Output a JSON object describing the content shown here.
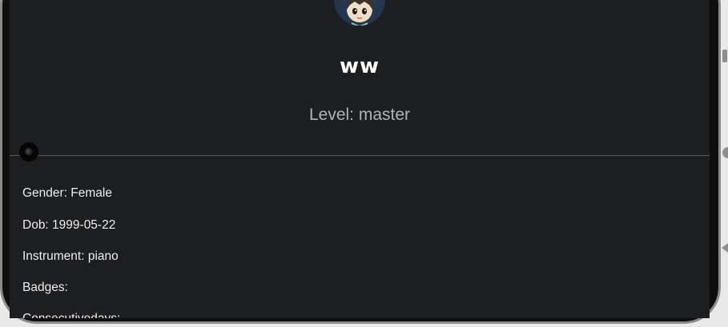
{
  "profile": {
    "username": "ww",
    "level": "Level: master"
  },
  "details": {
    "gender": "Gender: Female",
    "dob": "Dob: 1999-05-22",
    "instrument": "Instrument: piano",
    "badges": "Badges:",
    "consecutive_days": "Consecutivedays:"
  },
  "colors": {
    "background": "#1d1e20",
    "text": "#ececec",
    "muted_text": "#b3b3b3",
    "divider": "#55575a"
  }
}
